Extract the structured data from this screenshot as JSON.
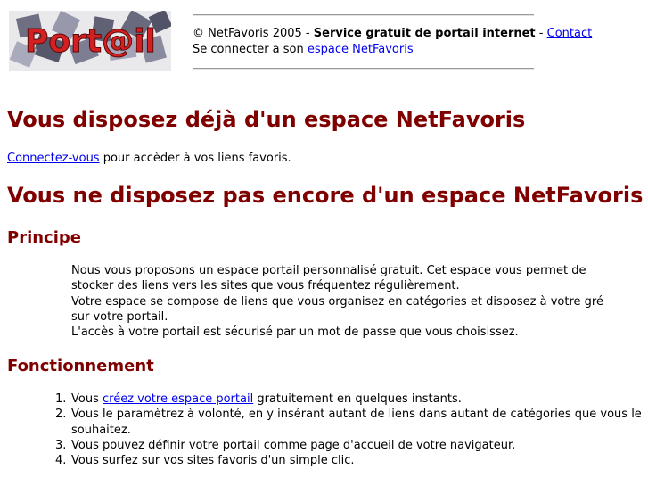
{
  "header": {
    "logo_text": "Port@il",
    "copyright": "© NetFavoris 2005 - ",
    "service": "Service gratuit de portail internet",
    "sep": " - ",
    "contact_link": "Contact",
    "connect_prefix": "Se connecter a son ",
    "connect_link": "espace NetFavoris"
  },
  "section_existing": {
    "title": "Vous disposez déjà d'un espace NetFavoris",
    "login_link": "Connectez-vous",
    "login_suffix": " pour accèder à vos liens favoris."
  },
  "section_new": {
    "title": "Vous ne disposez pas encore d'un espace NetFavoris"
  },
  "principle": {
    "title": "Principe",
    "lines": [
      "Nous vous proposons un espace portail personnalisé gratuit. Cet espace vous permet de stocker des liens vers les sites que vous fréquentez régulièrement.",
      "Votre espace se compose de liens que vous organisez en catégories et disposez à votre gré sur votre portail.",
      "L'accès à votre portail est sécurisé par un mot de passe que vous choisissez."
    ]
  },
  "functioning": {
    "title": "Fonctionnement",
    "steps": [
      {
        "num": "1.",
        "prefix": "Vous ",
        "link": "créez votre espace portail",
        "suffix": " gratuitement en quelques instants."
      },
      {
        "num": "2.",
        "text": "Vous le paramètrez à volonté, en y insérant autant de liens dans autant de catégories que vous le souhaitez."
      },
      {
        "num": "3.",
        "text": "Vous pouvez définir votre portail comme page d'accueil de votre navigateur."
      },
      {
        "num": "4.",
        "text": "Vous surfez sur vos sites favoris d'un simple clic."
      }
    ]
  }
}
